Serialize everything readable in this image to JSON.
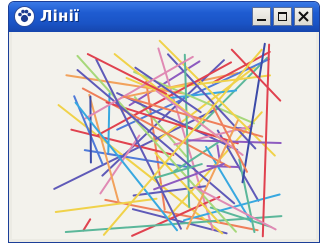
{
  "window": {
    "title": "Лінії"
  },
  "title_bar": {
    "icon": "paw-icon",
    "buttons": [
      {
        "name": "minimize",
        "icon": "minimize-icon"
      },
      {
        "name": "maximize",
        "icon": "maximize-icon"
      },
      {
        "name": "close",
        "icon": "close-icon"
      }
    ]
  },
  "colors": {
    "titlebar": "#1f5cd1",
    "client_background": "#f3f2ec",
    "line_palette": [
      "#3b4aa8",
      "#4f7ad8",
      "#5f5ab8",
      "#e0424f",
      "#ef7f5a",
      "#f2a25c",
      "#8d5bc0",
      "#5bb79a",
      "#f0d24a",
      "#e08ab4",
      "#a7d87b",
      "#38a8e0"
    ]
  }
}
